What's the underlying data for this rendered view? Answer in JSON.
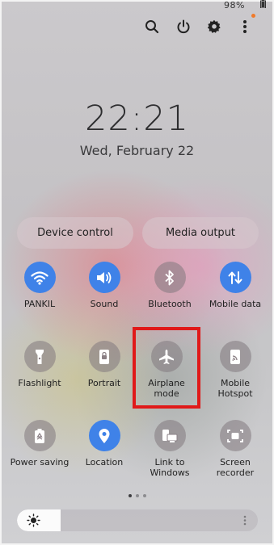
{
  "status_bar": {
    "battery_text": "98%"
  },
  "header_actions": [
    {
      "name": "search-icon"
    },
    {
      "name": "power-icon"
    },
    {
      "name": "gear-icon"
    },
    {
      "name": "more-options-icon"
    }
  ],
  "lock": {
    "time": "22:21",
    "date": "Wed, February 22"
  },
  "pills": {
    "device_control": "Device control",
    "media_output": "Media output"
  },
  "tiles": [
    {
      "label": "PANKIL",
      "icon": "wifi-icon",
      "active": true
    },
    {
      "label": "Sound",
      "icon": "speaker-icon",
      "active": true
    },
    {
      "label": "Bluetooth",
      "icon": "bluetooth-icon",
      "active": false
    },
    {
      "label": "Mobile data",
      "icon": "mobile-data-icon",
      "active": true
    },
    {
      "label": "Flashlight",
      "icon": "flashlight-icon",
      "active": false
    },
    {
      "label": "Portrait",
      "icon": "portrait-lock-icon",
      "active": false
    },
    {
      "label": "Airplane mode",
      "icon": "airplane-icon",
      "active": false
    },
    {
      "label": "Mobile Hotspot",
      "icon": "hotspot-icon",
      "active": false
    },
    {
      "label": "Power saving",
      "icon": "power-saving-icon",
      "active": false
    },
    {
      "label": "Location",
      "icon": "location-icon",
      "active": true
    },
    {
      "label": "Link to Windows",
      "icon": "link-to-windows-icon",
      "active": false
    },
    {
      "label": "Screen recorder",
      "icon": "screen-recorder-icon",
      "active": false
    }
  ],
  "pager": {
    "pages": 3,
    "current": 1
  },
  "brightness": {
    "level": 0.18
  },
  "colors": {
    "accent": "#3f82e8",
    "highlight": "#e01919",
    "badge": "#f07a2a"
  }
}
